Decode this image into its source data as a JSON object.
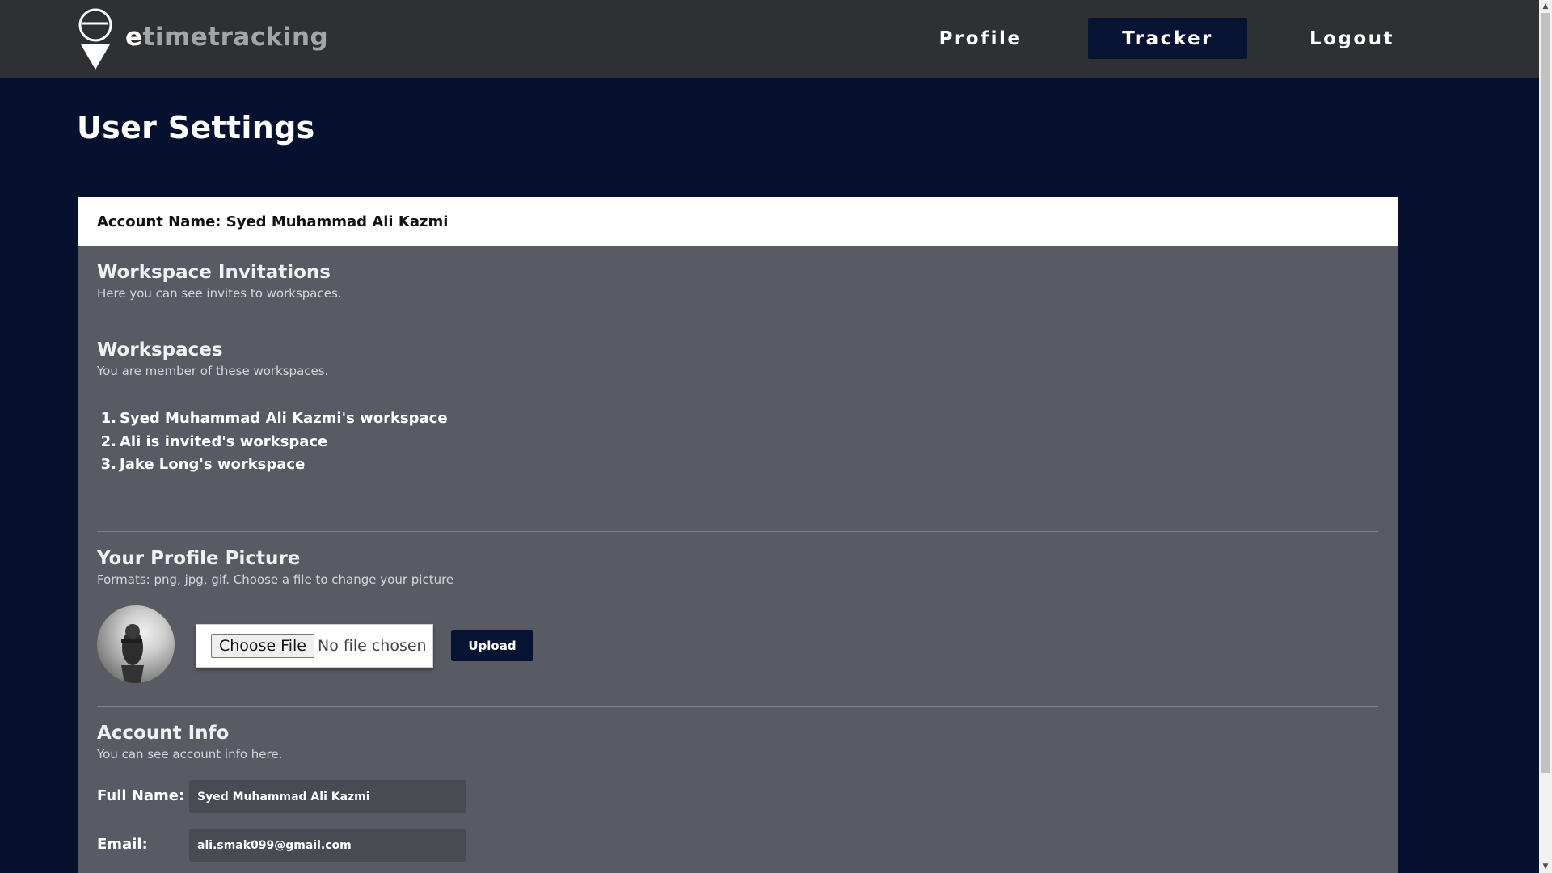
{
  "app": {
    "logo_text_first": "e",
    "logo_text_rest": "timetracking",
    "logo_icon": "location-pin-logo-icon"
  },
  "nav": {
    "profile": "Profile",
    "tracker": "Tracker",
    "logout": "Logout",
    "active": "Tracker"
  },
  "page": {
    "title": "User Settings"
  },
  "card": {
    "account_name": "Account Name: Syed Muhammad Ali Kazmi"
  },
  "invitations": {
    "title": "Workspace Invitations",
    "subtitle": "Here you can see invites to workspaces."
  },
  "workspaces": {
    "title": "Workspaces",
    "subtitle": "You are member of these workspaces.",
    "items": [
      {
        "num": "1.",
        "name": "Syed Muhammad Ali Kazmi's workspace"
      },
      {
        "num": "2.",
        "name": "Ali is invited's workspace"
      },
      {
        "num": "3.",
        "name": "Jake Long's workspace"
      }
    ]
  },
  "profile_picture": {
    "title": "Your Profile Picture",
    "subtitle": "Formats: png, jpg, gif. Choose a file to change your picture",
    "choose_file_label": "Choose File",
    "no_file_text": "No file chosen",
    "upload_label": "Upload"
  },
  "account_info": {
    "title": "Account Info",
    "subtitle": "You can see account info here.",
    "full_name_label": "Full Name:",
    "full_name_value": "Syed Muhammad Ali Kazmi",
    "email_label": "Email:",
    "email_value": "ali.smak099@gmail.com"
  },
  "colors": {
    "topbar": "#2e3134",
    "page_bg": "#061130",
    "card_body": "#595b64",
    "accent_button": "#071333"
  }
}
